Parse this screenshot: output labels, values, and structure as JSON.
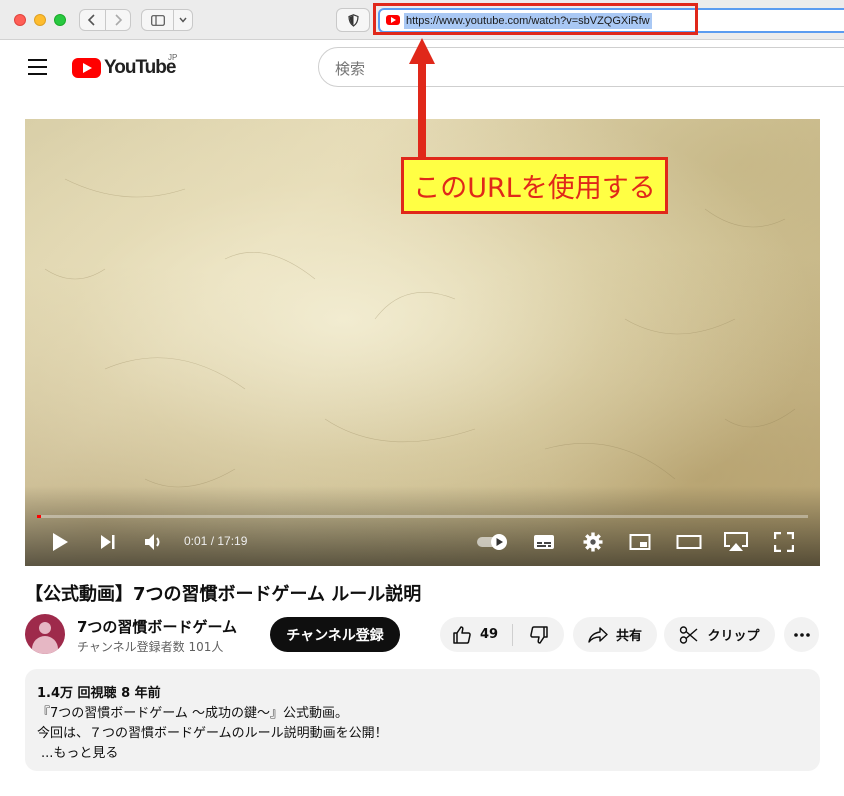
{
  "browser": {
    "url": "https://www.youtube.com/watch?v=sbVZQGXiRfw"
  },
  "header": {
    "logo_text": "YouTube",
    "country_code": "JP",
    "search_placeholder": "検索"
  },
  "player": {
    "time": "0:01 / 17:19",
    "progress": 0.001,
    "controls": [
      "play-icon",
      "next-icon",
      "volume-icon",
      "autoplay-toggle-icon",
      "subtitles-icon",
      "settings-icon",
      "miniplayer-icon",
      "theater-icon",
      "airplay-icon",
      "fullscreen-icon"
    ]
  },
  "annotation": {
    "text": "このURLを使用する",
    "color": "#e0281a",
    "background": "#ffff44"
  },
  "video": {
    "title": "【公式動画】7つの習慣ボードゲーム ルール説明",
    "channel_name": "7つの習慣ボードゲーム",
    "subscribers": "チャンネル登録者数 101人",
    "subscribe_label": "チャンネル登録",
    "likes": "49",
    "share_label": "共有",
    "clip_label": "クリップ"
  },
  "description": {
    "stats": "1.4万 回視聴  8 年前",
    "lines": [
      "『7つの習慣ボードゲーム 〜成功の鍵〜』公式動画。",
      "今回は、７つの習慣ボードゲームのルール説明動画を公開！"
    ],
    "more_label": "...もっと見る"
  },
  "colors": {
    "youtube_red": "#ff0000",
    "highlight_red": "#e0281a"
  }
}
